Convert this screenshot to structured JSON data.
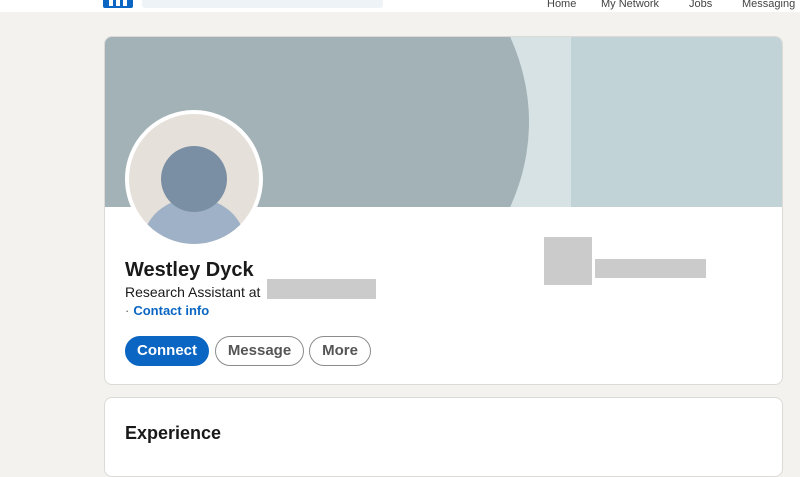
{
  "nav": {
    "search_placeholder": "",
    "items": [
      {
        "label": "Home"
      },
      {
        "label": "My Network"
      },
      {
        "label": "Jobs"
      },
      {
        "label": "Messaging"
      }
    ]
  },
  "profile": {
    "name": "Westley Dyck",
    "headline_prefix": "Research Assistant at",
    "contact_separator": "·",
    "contact_label": "Contact info",
    "actions": {
      "connect_label": "Connect",
      "message_label": "Message",
      "more_label": "More"
    }
  },
  "sections": {
    "experience_title": "Experience"
  },
  "colors": {
    "brand": "#0a66c2",
    "page_background": "#f3f2ef",
    "banner": "#a2b2b6",
    "redaction": "#cbcbcb"
  },
  "icons": {
    "logo": "linkedin-logo-icon",
    "avatar": "default-avatar-icon"
  }
}
